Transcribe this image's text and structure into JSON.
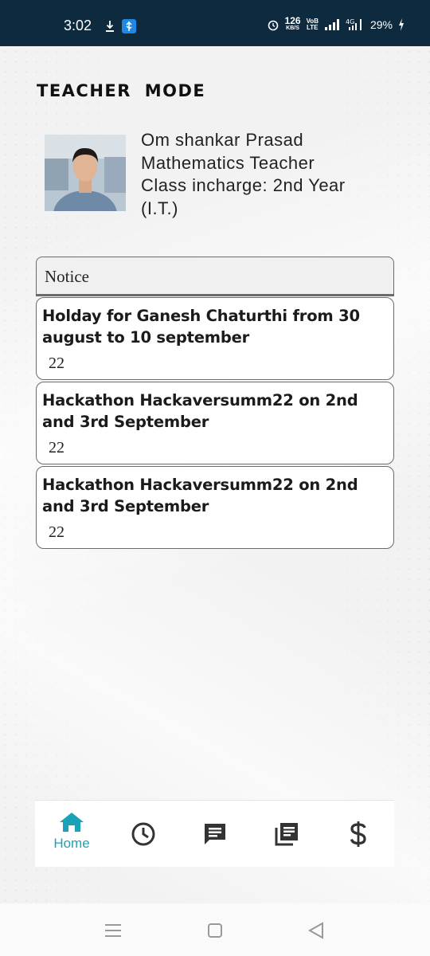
{
  "status_bar": {
    "time": "3:02",
    "net_speed": "126",
    "net_unit": "KB/S",
    "volte_top": "VoB",
    "volte_bottom": "LTE",
    "battery": "29%"
  },
  "header": {
    "title": "TEACHER MODE"
  },
  "profile": {
    "name": "Om shankar Prasad",
    "role": "Mathematics Teacher",
    "incharge": "Class incharge: 2nd Year",
    "incharge_cont": "(I.T.)"
  },
  "notice": {
    "header": "Notice",
    "items": [
      {
        "title": "Holday for Ganesh Chaturthi from 30 august to 10 september",
        "year": "22"
      },
      {
        "title": "Hackathon Hackaversumm22 on 2nd and 3rd September",
        "year": "22"
      },
      {
        "title": "Hackathon Hackaversumm22 on 2nd and 3rd September",
        "year": "22"
      }
    ]
  },
  "bottom_nav": {
    "active_color": "#1aa3b8",
    "items": [
      {
        "icon": "home-icon",
        "label": "Home"
      },
      {
        "icon": "clock-icon"
      },
      {
        "icon": "chat-icon"
      },
      {
        "icon": "library-icon"
      },
      {
        "icon": "dollar-icon"
      }
    ]
  }
}
